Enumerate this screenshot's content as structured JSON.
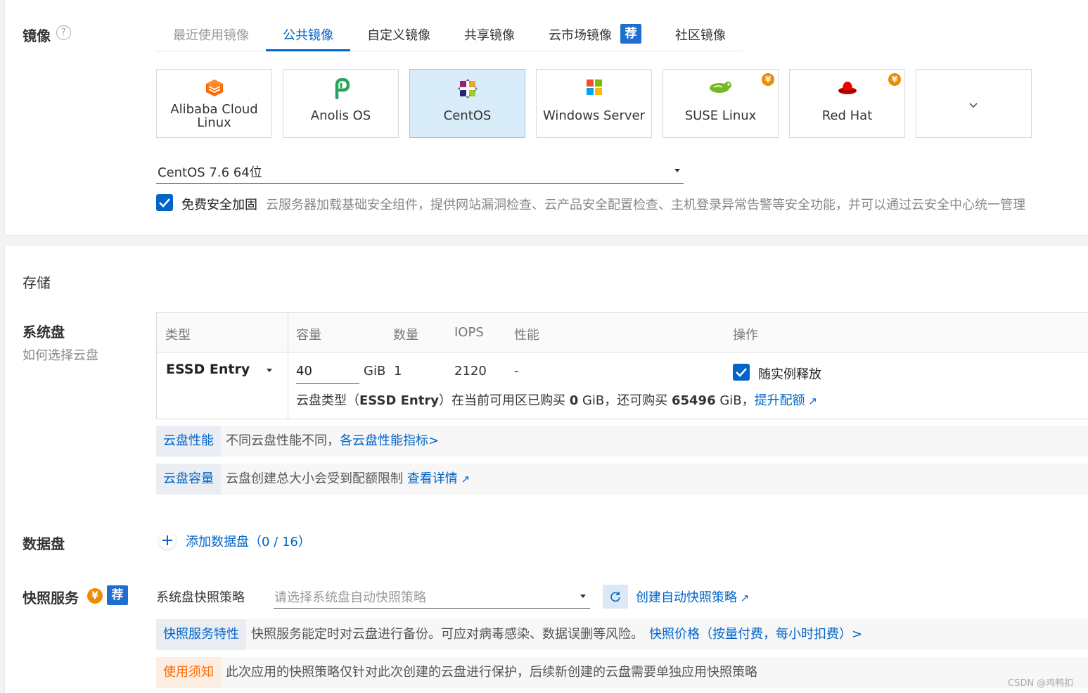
{
  "image_section": {
    "title": "镜像",
    "help_icon": "question-circle-icon",
    "tabs": [
      {
        "label": "最近使用镜像"
      },
      {
        "label": "公共镜像"
      },
      {
        "label": "自定义镜像"
      },
      {
        "label": "共享镜像"
      },
      {
        "label": "云市场镜像",
        "badge": "荐"
      },
      {
        "label": "社区镜像"
      }
    ],
    "active_tab": "公共镜像",
    "os_cards": [
      {
        "name": "Alibaba Cloud Linux",
        "line1": "Alibaba Cloud",
        "line2": "Linux",
        "icon": "alibaba-cloud-icon",
        "paid": false
      },
      {
        "name": "Anolis OS",
        "icon": "anolis-icon",
        "paid": false
      },
      {
        "name": "CentOS",
        "icon": "centos-icon",
        "paid": false
      },
      {
        "name": "Windows Server",
        "icon": "windows-icon",
        "paid": false
      },
      {
        "name": "SUSE Linux",
        "icon": "suse-icon",
        "paid": true
      },
      {
        "name": "Red Hat",
        "icon": "redhat-icon",
        "paid": true
      },
      {
        "name": "",
        "icon": "chevron-down-icon"
      }
    ],
    "selected_os": "CentOS",
    "paid_badge": "¥",
    "version_select": {
      "value": "CentOS 7.6 64位"
    },
    "security": {
      "checked": true,
      "label": "免费安全加固",
      "desc": "云服务器加载基础安全组件，提供网站漏洞检查、云产品安全配置检查、主机登录异常告警等安全功能，并可以通过云安全中心统一管理"
    }
  },
  "storage_section": {
    "title": "存储",
    "system_disk": {
      "label": "系统盘",
      "help_link": "如何选择云盘",
      "columns": [
        "类型",
        "容量",
        "数量",
        "IOPS",
        "性能",
        "操作"
      ],
      "type_value": "ESSD Entry",
      "capacity_value": "40",
      "capacity_unit": "GiB",
      "quantity": "1",
      "iops": "2120",
      "performance": "-",
      "release_with_instance": {
        "checked": true,
        "label": "随实例释放"
      },
      "quota": {
        "prefix": "云盘类型（",
        "type": "ESSD Entry",
        "middle1": "）在当前可用区已购买 ",
        "bought": "0",
        "middle2": " GiB，还可购买 ",
        "remaining": "65496",
        "suffix": " GiB，",
        "link": "提升配额"
      }
    },
    "perf_bar": {
      "tag": "云盘性能",
      "text": "不同云盘性能不同，",
      "link": "各云盘性能指标>"
    },
    "capacity_bar": {
      "tag": "云盘容量",
      "text": "云盘创建总大小会受到配额限制 ",
      "link": "查看详情"
    },
    "data_disk": {
      "label": "数据盘",
      "add_label": "添加数据盘（",
      "count": "0 / 16",
      "close": "）"
    }
  },
  "snapshot_section": {
    "title": "快照服务",
    "paid_badge": "¥",
    "rec_badge": "荐",
    "policy_label": "系统盘快照策略",
    "policy_placeholder": "请选择系统盘自动快照策略",
    "create_link": "创建自动快照策略",
    "feature_bar": {
      "tag": "快照服务特性",
      "text": "快照服务能定时对云盘进行备份。可应对病毒感染、数据误删等风险。",
      "link": "快照价格（按量付费，每小时扣费）>"
    },
    "notice_bar": {
      "tag": "使用须知",
      "text": "此次应用的快照策略仅针对此次创建的云盘进行保护，后续新创建的云盘需要单独应用快照策略"
    }
  },
  "watermark": "CSDN @鸡鸭扣",
  "colors": {
    "primary": "#0064c8",
    "selected_card": "#d9ecfa",
    "paid": "#f08a00",
    "warning": "#ff6a00"
  }
}
